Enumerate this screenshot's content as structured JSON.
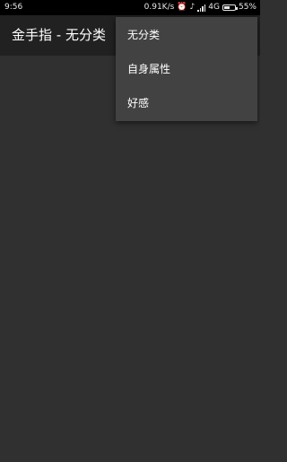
{
  "status_bar": {
    "time": "9:56",
    "network_speed": "0.91K/s",
    "network_type": "4G",
    "battery_percent": "55%",
    "battery_level": 0.55,
    "icons": [
      "alarm-icon",
      "silent-icon",
      "signal-icon",
      "battery-icon"
    ]
  },
  "app_bar": {
    "title": "金手指 - 无分类"
  },
  "overflow_menu": {
    "items": [
      {
        "label": "无分类"
      },
      {
        "label": "自身属性"
      },
      {
        "label": "好感"
      }
    ]
  },
  "colors": {
    "background": "#303030",
    "app_bar": "#212121",
    "menu": "#424242",
    "status_bar": "#000000",
    "text": "#ffffff"
  }
}
